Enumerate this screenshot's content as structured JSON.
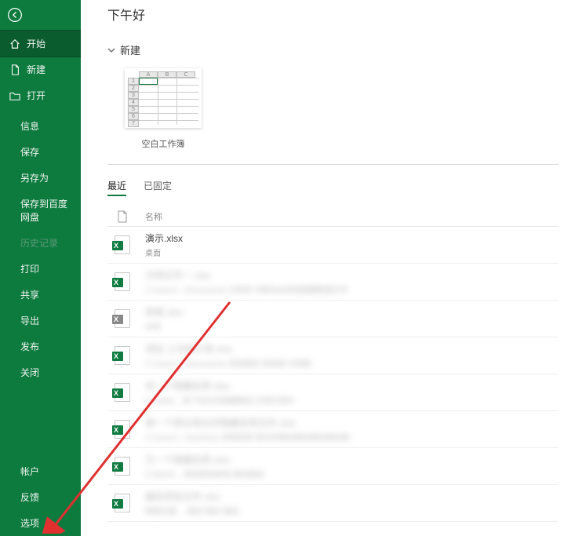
{
  "sidebar": {
    "items": [
      {
        "label": "开始",
        "name": "side-start",
        "icon": "home",
        "selected": true
      },
      {
        "label": "新建",
        "name": "side-new",
        "icon": "doc"
      },
      {
        "label": "打开",
        "name": "side-open",
        "icon": "folder"
      }
    ],
    "middle": [
      {
        "label": "信息",
        "name": "side-info"
      },
      {
        "label": "保存",
        "name": "side-save"
      },
      {
        "label": "另存为",
        "name": "side-saveas"
      },
      {
        "label": "保存到百度网盘",
        "name": "side-save-baidu"
      },
      {
        "label": "历史记录",
        "name": "side-history",
        "disabled": true
      },
      {
        "label": "打印",
        "name": "side-print"
      },
      {
        "label": "共享",
        "name": "side-share"
      },
      {
        "label": "导出",
        "name": "side-export"
      },
      {
        "label": "发布",
        "name": "side-publish"
      },
      {
        "label": "关闭",
        "name": "side-close"
      }
    ],
    "bottom": [
      {
        "label": "帐户",
        "name": "side-account"
      },
      {
        "label": "反馈",
        "name": "side-feedback"
      },
      {
        "label": "选项",
        "name": "side-options"
      }
    ]
  },
  "main": {
    "greeting": "下午好",
    "new_section": "新建",
    "templates": [
      {
        "label": "空白工作簿",
        "name": "tmpl-blank"
      }
    ],
    "tabs": [
      {
        "label": "最近",
        "active": true,
        "name": "tab-recent"
      },
      {
        "label": "已固定",
        "active": false,
        "name": "tab-pinned"
      }
    ],
    "list_hdr_name": "名称",
    "recent": [
      {
        "name": "演示.xlsx",
        "loc": "桌面",
        "blur": false,
        "icon": "x"
      },
      {
        "name": "示例文件一.xlsx",
        "loc": "C:\\Users\\...\\Documents 已修改 可能包含其他隐藏数据文字",
        "blur": true,
        "icon": "x"
      },
      {
        "name": "表格.xlsx",
        "loc": "本地",
        "blur": true,
        "icon": "alt"
      },
      {
        "name": "项目 工作统计表.xlsx",
        "loc": "C:\\Users\\...\\Documents 其他路径 某某某 示例路",
        "blur": true,
        "icon": "x"
      },
      {
        "name": "另一个隐藏名称.xlsx",
        "loc": "D:\\Data\\... 某个较长的隐藏路径 示例示例示",
        "blur": true,
        "icon": "x"
      },
      {
        "name": "再一个很长很长的隐藏名称文件.xlsx",
        "loc": "C:\\Users\\...\\OneDrive 某某某某 很长的路径路径路径路径路",
        "blur": true,
        "icon": "x"
      },
      {
        "name": "又一个隐藏名称.xlsx",
        "loc": "E:\\Work\\... 其他其他其他 路径路径",
        "blur": true,
        "icon": "x"
      },
      {
        "name": "最后项目文件.xlsx",
        "loc": "网络位置 ... 路径 路径 路径",
        "blur": true,
        "icon": "x"
      }
    ]
  }
}
